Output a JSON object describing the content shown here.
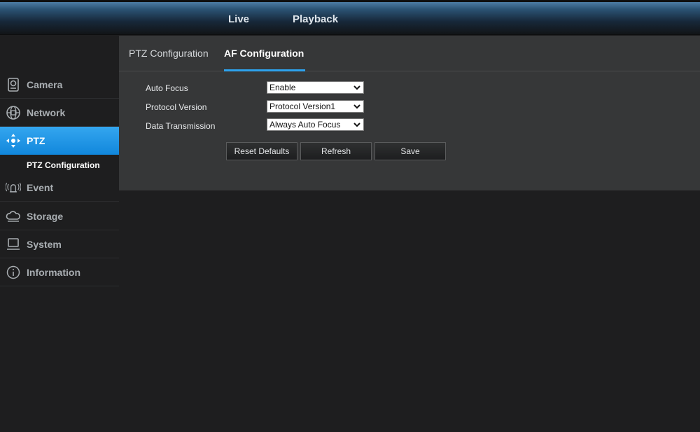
{
  "topnav": {
    "live": "Live",
    "playback": "Playback"
  },
  "sidebar": {
    "items": [
      {
        "label": "Camera",
        "icon": "camera-icon"
      },
      {
        "label": "Network",
        "icon": "network-icon"
      },
      {
        "label": "PTZ",
        "icon": "ptz-icon",
        "active": true
      },
      {
        "label": "Event",
        "icon": "event-icon"
      },
      {
        "label": "Storage",
        "icon": "storage-icon"
      },
      {
        "label": "System",
        "icon": "system-icon"
      },
      {
        "label": "Information",
        "icon": "information-icon"
      }
    ],
    "sub_item": "PTZ Configuration"
  },
  "tabs": {
    "ptz": "PTZ Configuration",
    "af": "AF Configuration"
  },
  "form": {
    "auto_focus": {
      "label": "Auto Focus",
      "value": "Enable"
    },
    "protocol_version": {
      "label": "Protocol Version",
      "value": "Protocol Version1"
    },
    "data_transmission": {
      "label": "Data Transmission",
      "value": "Always Auto Focus"
    }
  },
  "buttons": {
    "reset": "Reset Defaults",
    "refresh": "Refresh",
    "save": "Save"
  },
  "colors": {
    "accent": "#1a8fe0",
    "panel": "#363738",
    "background": "#1e1e1f"
  }
}
